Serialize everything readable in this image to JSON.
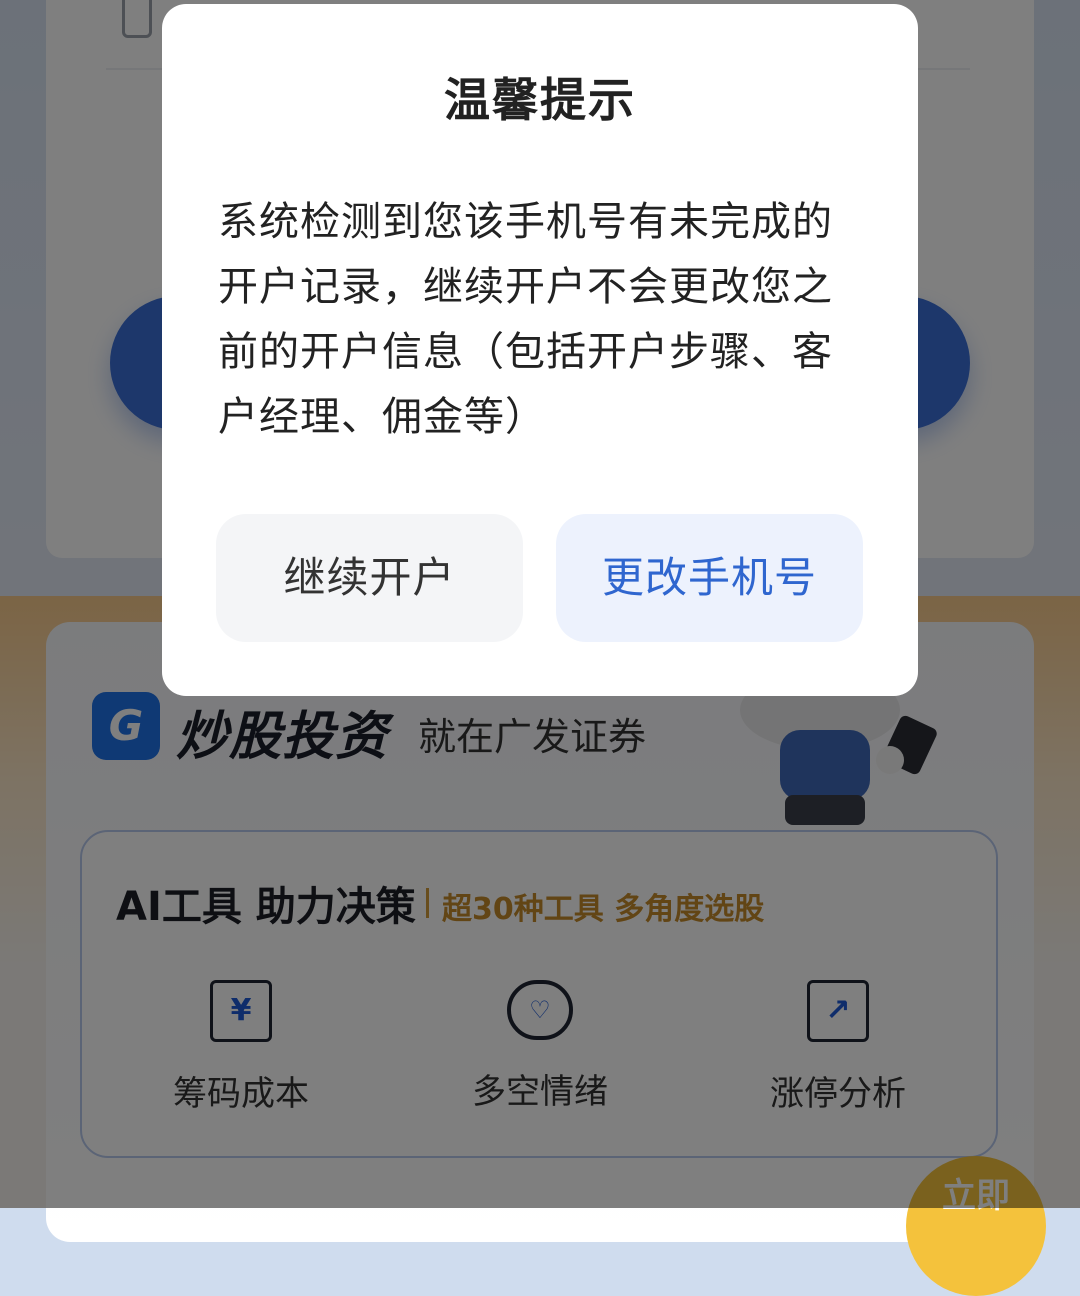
{
  "background": {
    "promo": {
      "brand_logo_text": "G",
      "title": "炒股投资",
      "subtitle": "就在广发证券"
    },
    "ai_tools": {
      "title": "AI工具 助力决策",
      "tags": "超30种工具 多角度选股",
      "items": [
        {
          "label": "筹码成本",
          "icon": "yen-board-icon",
          "glyph": "¥"
        },
        {
          "label": "多空情绪",
          "icon": "heart-chat-icon",
          "glyph": "♡"
        },
        {
          "label": "涨停分析",
          "icon": "trend-board-icon",
          "glyph": "↗"
        }
      ]
    },
    "fab_label": "立即"
  },
  "dialog": {
    "title": "温馨提示",
    "message": "系统检测到您该手机号有未完成的开户记录，继续开户不会更改您之前的开户信息（包括开户步骤、客户经理、佣金等）",
    "continue_button": "继续开户",
    "change_button": "更改手机号"
  },
  "colors": {
    "accent": "#2f66cf",
    "overlay": "rgba(0,0,0,0.5)",
    "tag_gold": "#c48a2a"
  }
}
